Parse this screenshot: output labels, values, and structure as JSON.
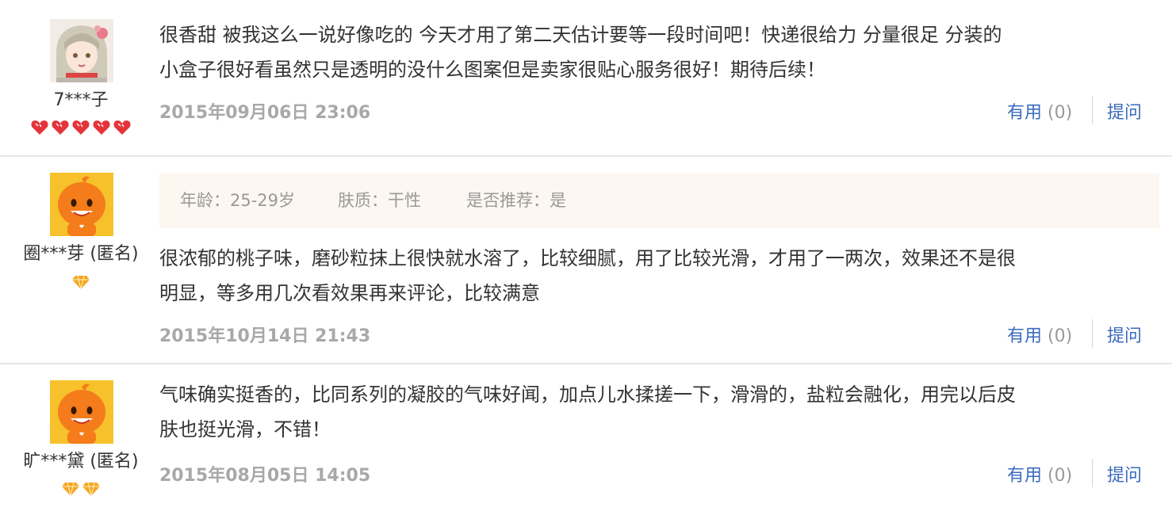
{
  "reviews": [
    {
      "user": {
        "name": "7***子",
        "level_icons": 5,
        "level_type": "heart"
      },
      "tags": null,
      "content_lines": [
        "很香甜 被我这么一说好像吃的 今天才用了第二天估计要等一段时间吧！快递很给力 分量很足 分装的",
        "小盒子很好看虽然只是透明的没什么图案但是卖家很贴心服务很好！期待后续！"
      ],
      "date": "2015年09月06日 23:06",
      "useful_label": "有用",
      "useful_count": "(0)",
      "ask_label": "提问"
    },
    {
      "user": {
        "name": "圈***芽 (匿名)",
        "level_icons": 1,
        "level_type": "diamond"
      },
      "tags": {
        "age": "年龄：25-29岁",
        "skin": "肤质：干性",
        "recommend": "是否推荐：是"
      },
      "content_lines": [
        "很浓郁的桃子味，磨砂粒抹上很快就水溶了，比较细腻，用了比较光滑，才用了一两次，效果还不是很",
        "明显，等多用几次看效果再来评论，比较满意"
      ],
      "date": "2015年10月14日 21:43",
      "useful_label": "有用",
      "useful_count": "(0)",
      "ask_label": "提问"
    },
    {
      "user": {
        "name": "旷***黛 (匿名)",
        "level_icons": 2,
        "level_type": "diamond"
      },
      "tags": null,
      "content_lines": [
        "气味确实挺香的，比同系列的凝胶的气味好闻，加点儿水揉搓一下，滑滑的，盐粒会融化，用完以后皮",
        "肤也挺光滑，不错！"
      ],
      "date": "2015年08月05日 14:05",
      "useful_label": "有用",
      "useful_count": "(0)",
      "ask_label": "提问"
    }
  ],
  "colors": {
    "link": "#3a6bbd",
    "muted": "#999999",
    "date": "#a8a8a8",
    "tag_bg": "#fdf7f1",
    "heart": "#e4343b",
    "diamond": "#f5a623",
    "avatar_orange": "#f47c1a"
  },
  "icons": {
    "avatar_1": "anime-girl-avatar",
    "avatar_2": "taobao-mascot-avatar",
    "avatar_3": "taobao-mascot-avatar",
    "level_heart": "heart-icon",
    "level_diamond": "diamond-icon"
  }
}
